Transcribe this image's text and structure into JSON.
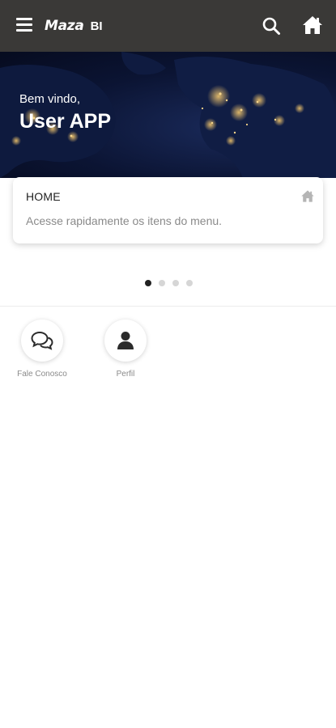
{
  "app": {
    "logo_main": "Maza",
    "logo_sub": "BI"
  },
  "header": {
    "menu_icon": "hamburger-menu-icon",
    "search_icon": "search-icon",
    "home_icon": "home-icon"
  },
  "hero": {
    "welcome": "Bem vindo,",
    "username": "User APP"
  },
  "card": {
    "title": "HOME",
    "subtitle": "Acesse rapidamente os itens do menu.",
    "icon": "home-icon"
  },
  "carousel": {
    "pages": 4,
    "active_index": 0
  },
  "shortcuts": [
    {
      "label": "Fale Conosco",
      "icon": "chat-bubbles-icon"
    },
    {
      "label": "Perfil",
      "icon": "user-icon"
    }
  ],
  "colors": {
    "appbar": "#3a3937",
    "hero_bg": "#0b1433",
    "city_lights": "#f2c66d"
  }
}
